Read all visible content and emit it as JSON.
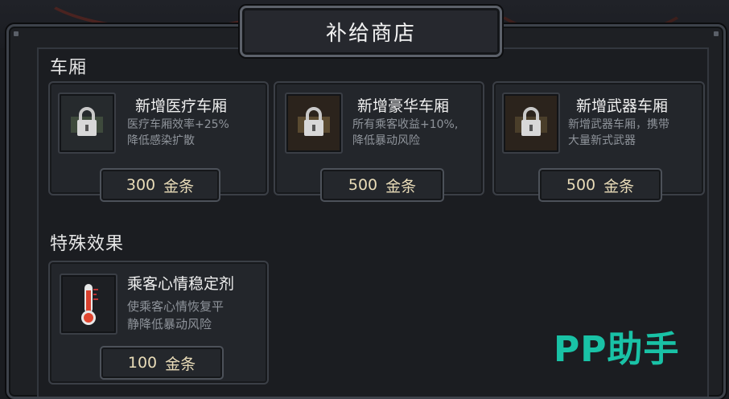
{
  "shop": {
    "title": "补给商店",
    "currency_unit": "金条"
  },
  "sections": {
    "carriages": {
      "title": "车厢",
      "items": [
        {
          "name": "新增医疗车厢",
          "desc_line1": "医疗车厢效率+25%",
          "desc_line2": "降低感染扩散",
          "price": "300",
          "icon": "padlock-icon"
        },
        {
          "name": "新增豪华车厢",
          "desc_line1": "所有乘客收益+10%,",
          "desc_line2": "降低暴动风险",
          "price": "500",
          "icon": "padlock-icon"
        },
        {
          "name": "新增武器车厢",
          "desc_line1": "新增武器车厢，携带",
          "desc_line2": "大量新式武器",
          "price": "500",
          "icon": "padlock-icon"
        }
      ]
    },
    "effects": {
      "title": "特殊效果",
      "items": [
        {
          "name": "乘客心情稳定剂",
          "desc_line1": "使乘客心情恢复平",
          "desc_line2": "静降低暴动风险",
          "price": "100",
          "icon": "thermometer-icon"
        }
      ]
    }
  },
  "watermark": "PP助手",
  "colors": {
    "accent_watermark": "#19c2a6",
    "price_text": "#e9dcb8"
  }
}
